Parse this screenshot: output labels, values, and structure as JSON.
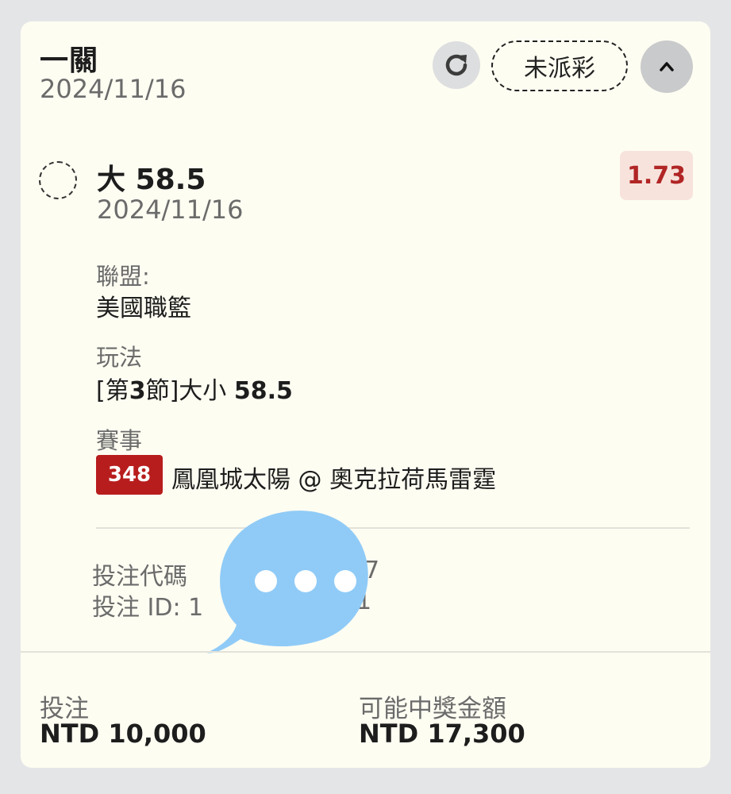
{
  "bet": {
    "type_title": "一關",
    "date": "2024/11/16",
    "status_label": "未派彩"
  },
  "selection": {
    "title_prefix": "大",
    "title_value": "58.5",
    "date": "2024/11/16",
    "odds": "1.73"
  },
  "details": {
    "league_label": "聯盟:",
    "league_value": "美國職籃",
    "market_label": "玩法",
    "market_value_pre": "[第",
    "market_value_num": "3",
    "market_value_mid": "節]大小 ",
    "market_value_line": "58.5",
    "event_label": "賽事",
    "event_number": "348",
    "event_name": "鳳凰城太陽 @ 奧克拉荷馬雷霆"
  },
  "codes": {
    "bet_code_label": "投注代碼",
    "bet_code_tail": "7",
    "bet_id_label": "投注 ID: 1",
    "bet_id_tail": "1"
  },
  "footer": {
    "stake_label": "投注",
    "stake_value": "NTD 10,000",
    "payout_label": "可能中獎金額",
    "payout_value": "NTD 17,300"
  },
  "colors": {
    "page_bg": "#e4e5e7",
    "card_bg": "#fefdf2",
    "odds_text": "#b12525",
    "odds_bg": "#f7e3dc",
    "event_badge_bg": "#b81d1d",
    "chat_bubble": "#90cbf7"
  },
  "icons": {
    "refresh": "refresh-icon",
    "collapse": "chevron-up-icon",
    "chat": "chat-bubble-icon"
  }
}
